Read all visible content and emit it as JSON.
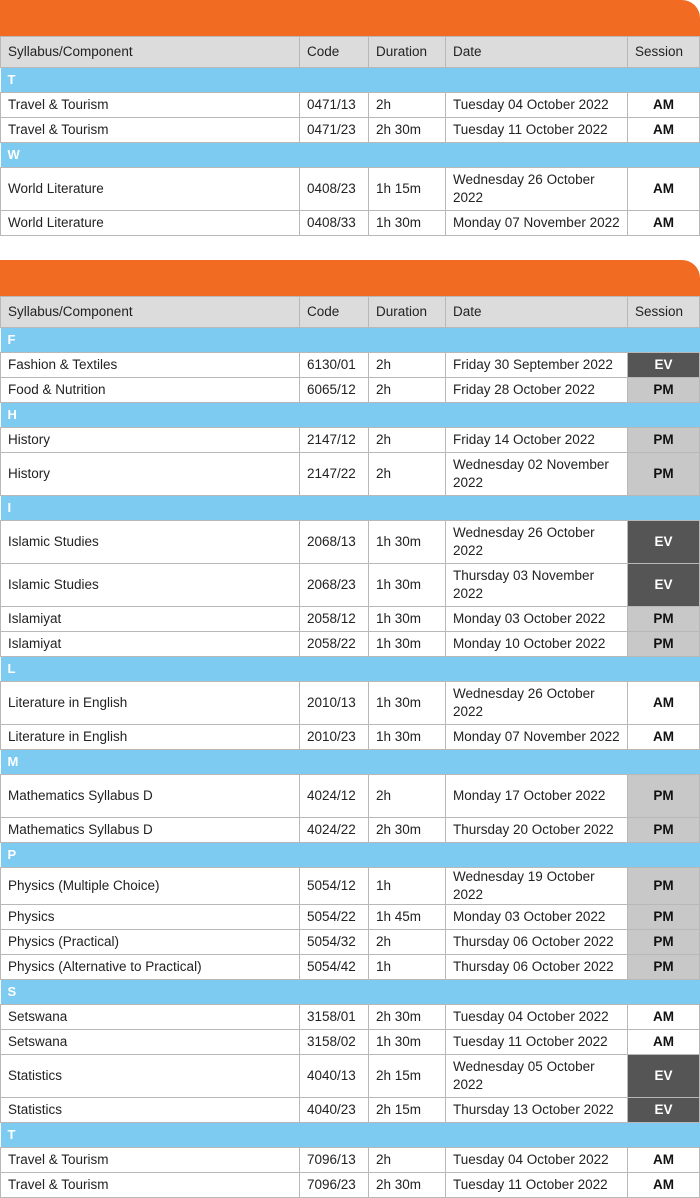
{
  "headers": {
    "c1": "Syllabus/Component",
    "c2": "Code",
    "c3": "Duration",
    "c4": "Date",
    "c5": "Session"
  },
  "tables": [
    {
      "groups": [
        {
          "letter": "T",
          "rows": [
            {
              "name": "Travel & Tourism",
              "code": "0471/13",
              "duration": "2h",
              "date": "Tuesday 04 October 2022",
              "session": "AM"
            },
            {
              "name": "Travel & Tourism",
              "code": "0471/23",
              "duration": "2h 30m",
              "date": "Tuesday 11 October 2022",
              "session": "AM"
            }
          ]
        },
        {
          "letter": "W",
          "rows": [
            {
              "name": "World Literature",
              "code": "0408/23",
              "duration": "1h 15m",
              "date": "Wednesday 26 October 2022",
              "session": "AM"
            },
            {
              "name": "World Literature",
              "code": "0408/33",
              "duration": "1h 30m",
              "date": "Monday 07 November 2022",
              "session": "AM"
            }
          ]
        }
      ]
    },
    {
      "groups": [
        {
          "letter": "F",
          "rows": [
            {
              "name": "Fashion & Textiles",
              "code": "6130/01",
              "duration": "2h",
              "date": "Friday 30 September 2022",
              "session": "EV"
            },
            {
              "name": "Food & Nutrition",
              "code": "6065/12",
              "duration": "2h",
              "date": "Friday 28 October 2022",
              "session": "PM"
            }
          ]
        },
        {
          "letter": "H",
          "rows": [
            {
              "name": "History",
              "code": "2147/12",
              "duration": "2h",
              "date": "Friday 14 October 2022",
              "session": "PM"
            },
            {
              "name": "History",
              "code": "2147/22",
              "duration": "2h",
              "date": "Wednesday 02 November 2022",
              "session": "PM"
            }
          ]
        },
        {
          "letter": "I",
          "rows": [
            {
              "name": "Islamic Studies",
              "code": "2068/13",
              "duration": "1h 30m",
              "date": "Wednesday 26 October 2022",
              "session": "EV"
            },
            {
              "name": "Islamic Studies",
              "code": "2068/23",
              "duration": "1h 30m",
              "date": "Thursday 03 November 2022",
              "session": "EV"
            },
            {
              "name": "Islamiyat",
              "code": "2058/12",
              "duration": "1h 30m",
              "date": "Monday 03 October 2022",
              "session": "PM"
            },
            {
              "name": "Islamiyat",
              "code": "2058/22",
              "duration": "1h 30m",
              "date": "Monday 10 October 2022",
              "session": "PM"
            }
          ]
        },
        {
          "letter": "L",
          "rows": [
            {
              "name": "Literature in English",
              "code": "2010/13",
              "duration": "1h 30m",
              "date": "Wednesday 26 October 2022",
              "session": "AM"
            },
            {
              "name": "Literature in English",
              "code": "2010/23",
              "duration": "1h 30m",
              "date": "Monday 07 November 2022",
              "session": "AM"
            }
          ]
        },
        {
          "letter": "M",
          "rows": [
            {
              "name": "Mathematics Syllabus D",
              "code": "4024/12",
              "duration": "2h",
              "date": "Monday 17 October 2022",
              "session": "PM"
            },
            {
              "name": "Mathematics Syllabus D",
              "code": "4024/22",
              "duration": "2h 30m",
              "date": "Thursday 20 October 2022",
              "session": "PM"
            }
          ]
        },
        {
          "letter": "P",
          "rows": [
            {
              "name": "Physics (Multiple Choice)",
              "code": "5054/12",
              "duration": "1h",
              "date": "Wednesday 19 October 2022",
              "session": "PM"
            },
            {
              "name": "Physics",
              "code": "5054/22",
              "duration": "1h 45m",
              "date": "Monday 03 October 2022",
              "session": "PM"
            },
            {
              "name": "Physics (Practical)",
              "code": "5054/32",
              "duration": "2h",
              "date": "Thursday 06 October 2022",
              "session": "PM"
            },
            {
              "name": "Physics (Alternative to Practical)",
              "code": "5054/42",
              "duration": "1h",
              "date": "Thursday 06 October 2022",
              "session": "PM"
            }
          ]
        },
        {
          "letter": "S",
          "rows": [
            {
              "name": "Setswana",
              "code": "3158/01",
              "duration": "2h 30m",
              "date": "Tuesday 04 October 2022",
              "session": "AM"
            },
            {
              "name": "Setswana",
              "code": "3158/02",
              "duration": "1h 30m",
              "date": "Tuesday 11 October 2022",
              "session": "AM"
            },
            {
              "name": "Statistics",
              "code": "4040/13",
              "duration": "2h 15m",
              "date": "Wednesday 05 October 2022",
              "session": "EV"
            },
            {
              "name": "Statistics",
              "code": "4040/23",
              "duration": "2h 15m",
              "date": "Thursday 13 October 2022",
              "session": "EV"
            }
          ]
        },
        {
          "letter": "T",
          "rows": [
            {
              "name": "Travel & Tourism",
              "code": "7096/13",
              "duration": "2h",
              "date": "Tuesday 04 October 2022",
              "session": "AM"
            },
            {
              "name": "Travel & Tourism",
              "code": "7096/23",
              "duration": "2h 30m",
              "date": "Tuesday 11 October 2022",
              "session": "AM"
            }
          ]
        }
      ]
    }
  ]
}
